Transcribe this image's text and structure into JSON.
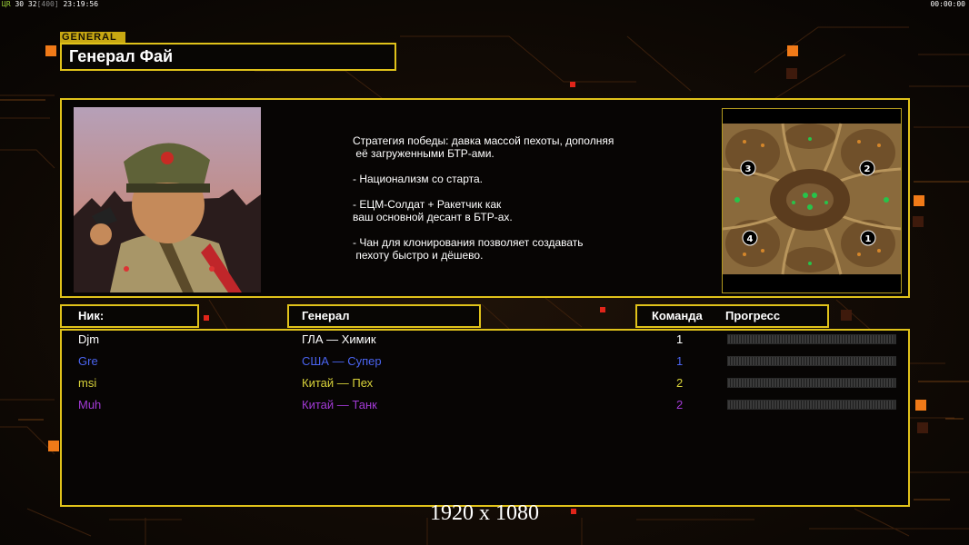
{
  "hud": {
    "left_prefix": "ЦR",
    "left_values": "30 32",
    "left_bracket": "[400]",
    "left_time": "23:19:56",
    "right_time": "00:00:00"
  },
  "general": {
    "section_label": "GENERAL",
    "name": "Генерал Фай"
  },
  "strategy_lines": [
    "Стратегия победы: давка массой пехоты, дополняя",
    " её загруженными БТР-ами.",
    "",
    "- Национализм со старта.",
    "",
    "- ЕЦМ-Солдат + Ракетчик как",
    "ваш основной десант в БТР-ах.",
    "",
    "- Чан для клонирования позволяет создавать",
    " пехоту быстро и дёшево."
  ],
  "minimap": {
    "spawns": [
      "1",
      "2",
      "3",
      "4"
    ]
  },
  "table": {
    "headers": {
      "nick": "Ник:",
      "general": "Генерал",
      "team": "Команда",
      "progress": "Прогресс"
    },
    "players": [
      {
        "nick": "Djm",
        "general": "ГЛА — Химик",
        "team": "1",
        "progress": 0,
        "color": "#ffffff"
      },
      {
        "nick": "Gre",
        "general": "США — Супер",
        "team": "1",
        "progress": 0,
        "color": "#4a64f0"
      },
      {
        "nick": "msi",
        "general": "Китай — Пех",
        "team": "2",
        "progress": 0,
        "color": "#d8d23a"
      },
      {
        "nick": "Muh",
        "general": "Китай — Танк",
        "team": "2",
        "progress": 0,
        "color": "#a33ad6"
      }
    ]
  },
  "resolution_label": "1920 x 1080",
  "colors": {
    "frame": "#e0c21a",
    "accent_orange": "#f07a18",
    "accent_red": "#e0251a",
    "background": "#0c0805"
  }
}
